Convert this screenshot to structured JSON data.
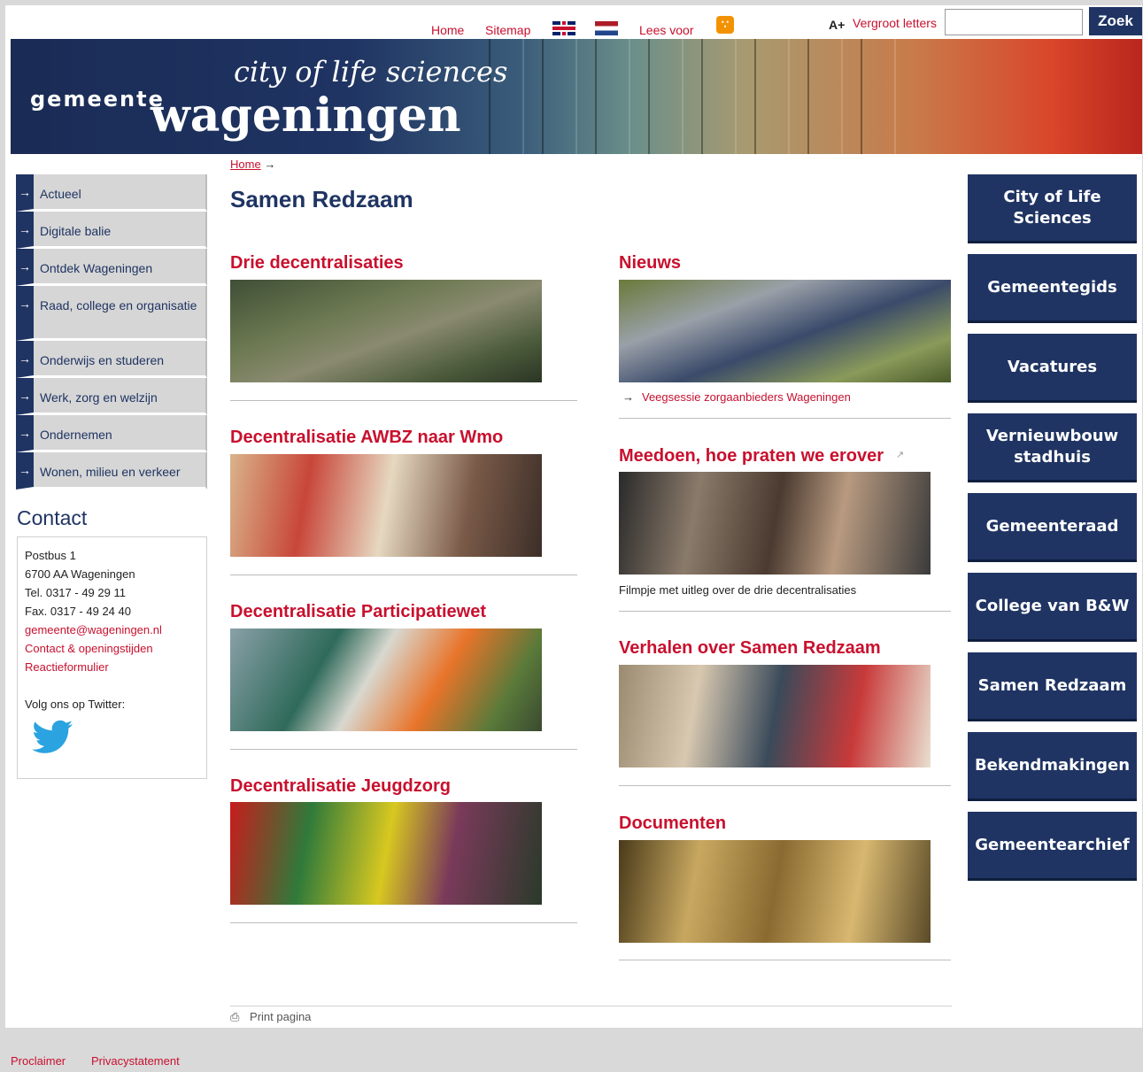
{
  "topbar": {
    "home": "Home",
    "sitemap": "Sitemap",
    "lees_voor": "Lees voor",
    "vergroot": "Vergroot letters",
    "aplus": "A+",
    "search_button": "Zoek",
    "search_value": ""
  },
  "banner": {
    "gemeente": "gemeente",
    "city": "city of life sciences",
    "wageningen": "wageningen"
  },
  "leftnav": [
    {
      "label": "Actueel"
    },
    {
      "label": "Digitale balie"
    },
    {
      "label": "Ontdek Wageningen"
    },
    {
      "label": "Raad, college en organisatie"
    },
    {
      "label": "Onderwijs en studeren"
    },
    {
      "label": "Werk, zorg en welzijn"
    },
    {
      "label": "Ondernemen"
    },
    {
      "label": "Wonen, milieu en verkeer"
    }
  ],
  "contact": {
    "title": "Contact",
    "line1": "Postbus 1",
    "line2": "6700 AA Wageningen",
    "tel": "Tel. 0317 - 49 29 11",
    "fax": "Fax. 0317 - 49 24 40",
    "email": "gemeente@wageningen.nl",
    "openingstijden": "Contact & openingstijden",
    "reactie": "Reactieformulier",
    "twitter": "Volg ons op Twitter:"
  },
  "breadcrumb": {
    "home": "Home",
    "sep": "→"
  },
  "main": {
    "title": "Samen Redzaam",
    "left_blocks": [
      {
        "title": "Drie decentralisaties"
      },
      {
        "title": "Decentralisatie AWBZ naar Wmo"
      },
      {
        "title": "Decentralisatie Participatiewet"
      },
      {
        "title": "Decentralisatie Jeugdzorg"
      }
    ],
    "right_blocks": [
      {
        "title": "Nieuws",
        "link": "Veegsessie zorgaanbieders Wageningen"
      },
      {
        "title": "Meedoen, hoe praten we erover",
        "caption": "Filmpje met uitleg over de drie decentralisaties"
      },
      {
        "title": "Verhalen over Samen Redzaam"
      },
      {
        "title": "Documenten"
      }
    ],
    "print": "Print pagina"
  },
  "rightnav": [
    {
      "label": "City of Life Sciences"
    },
    {
      "label": "Gemeentegids"
    },
    {
      "label": "Vacatures"
    },
    {
      "label": "Vernieuwbouw stadhuis"
    },
    {
      "label": "Gemeenteraad"
    },
    {
      "label": "College van B&W"
    },
    {
      "label": "Samen Redzaam"
    },
    {
      "label": "Bekendmakingen"
    },
    {
      "label": "Gemeentearchief"
    }
  ],
  "footer": {
    "proclaimer": "Proclaimer",
    "privacy": "Privacystatement"
  },
  "colors": {
    "brand_blue": "#1f3463",
    "accent_red": "#c8102e"
  }
}
